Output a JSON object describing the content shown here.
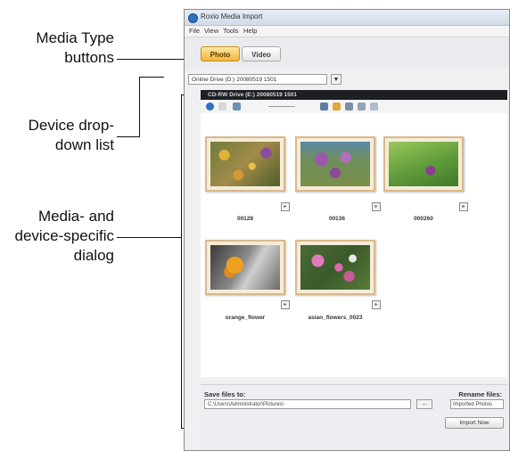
{
  "callouts": {
    "media_type": [
      "Media Type",
      "buttons"
    ],
    "device_dropdown": [
      "Device drop-",
      "down list"
    ],
    "dialog": [
      "Media- and",
      "device-specific",
      "dialog"
    ]
  },
  "window": {
    "title": "Roxio Media Import",
    "menu": [
      "File",
      "View",
      "Tools",
      "Help"
    ]
  },
  "media_tabs": {
    "photo": "Photo",
    "video": "Video"
  },
  "device": {
    "selected": "Online Drive (D:) 20080519 1501",
    "arrow": "▼"
  },
  "header_bar": "CD-RW Drive (E:) 20080519 1501",
  "thumbnails": [
    {
      "caption": "00128",
      "img": "t1"
    },
    {
      "caption": "00136",
      "img": "t2"
    },
    {
      "caption": "000260",
      "img": "t3"
    },
    {
      "caption": "orange_flower",
      "img": "t4"
    },
    {
      "caption": "asian_flowers_0023",
      "img": "t5"
    }
  ],
  "save": {
    "label": "Save files to:",
    "path": "C:\\Users\\Administrator\\Pictures\\",
    "browse": "...",
    "rename_label": "Rename files:",
    "rename_value": "Imported Photos",
    "import_button": "Import Now"
  },
  "colors": {
    "photo_tab": "#f3b33a",
    "header_bar": "#1d1f22"
  }
}
